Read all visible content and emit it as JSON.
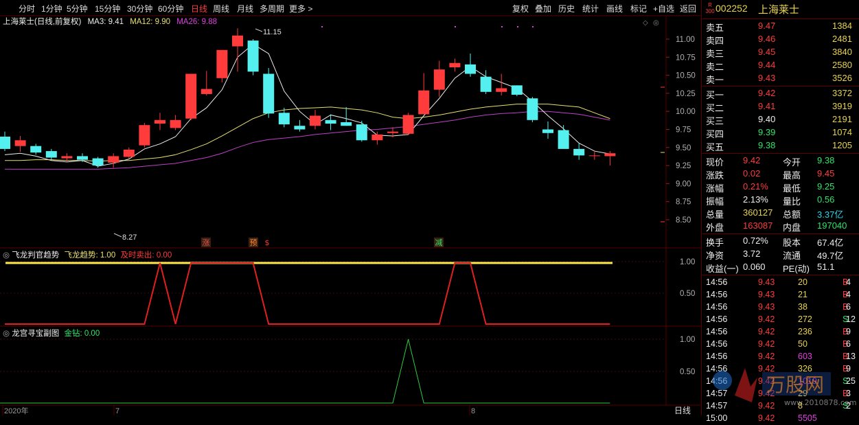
{
  "toolbar": {
    "left": [
      "分时",
      "1分钟",
      "5分钟",
      "15分钟",
      "30分钟",
      "60分钟",
      "日线",
      "周线",
      "月线",
      "多周期",
      "更多 >"
    ],
    "active_index": 6,
    "right": [
      "复权",
      "叠加",
      "历史",
      "统计",
      "画线",
      "标记",
      "+自选",
      "返回"
    ]
  },
  "main_info": {
    "title": "上海莱士(日线,前复权)",
    "ma3": "MA3: 9.41",
    "ma12": "MA12: 9.90",
    "ma26": "MA26: 9.88"
  },
  "price_axis": [
    "11.00",
    "10.75",
    "10.50",
    "10.25",
    "10.00",
    "9.75",
    "9.50",
    "9.25",
    "9.00",
    "8.75",
    "8.50"
  ],
  "annotations": {
    "high": "11.15",
    "low": "8.27",
    "signals": [
      "涨",
      "预",
      "$",
      "减"
    ]
  },
  "pane1": {
    "name": "飞龙判官趋势",
    "s1_label": "飞龙趋势: 1.00",
    "s2_label": "及时卖出: 0.00",
    "axis": [
      "1.00",
      "0.50"
    ]
  },
  "pane2": {
    "name": "龙宫寻宝副图",
    "s1_label": "金钻: 0.00",
    "axis": [
      "1.00",
      "0.50"
    ]
  },
  "x_axis": {
    "labels": [
      "2020年",
      "7",
      "8"
    ],
    "period": "日线"
  },
  "colors": {
    "up": "#ff3b3b",
    "down": "#54f0f0",
    "ma3": "#eeeeee",
    "ma12": "#e8e070",
    "ma26": "#c040c8"
  },
  "chart_data": {
    "type": "candlestick",
    "ylim": [
      8.27,
      11.15
    ],
    "candles": [
      {
        "o": 9.65,
        "h": 9.72,
        "l": 9.45,
        "c": 9.48
      },
      {
        "o": 9.52,
        "h": 9.66,
        "l": 9.44,
        "c": 9.6
      },
      {
        "o": 9.52,
        "h": 9.55,
        "l": 9.4,
        "c": 9.43
      },
      {
        "o": 9.45,
        "h": 9.48,
        "l": 9.33,
        "c": 9.36
      },
      {
        "o": 9.35,
        "h": 9.42,
        "l": 9.3,
        "c": 9.38
      },
      {
        "o": 9.38,
        "h": 9.42,
        "l": 9.3,
        "c": 9.33
      },
      {
        "o": 9.35,
        "h": 9.37,
        "l": 9.22,
        "c": 9.25
      },
      {
        "o": 9.29,
        "h": 9.42,
        "l": 9.22,
        "c": 9.38
      },
      {
        "o": 9.37,
        "h": 9.5,
        "l": 9.35,
        "c": 9.47
      },
      {
        "o": 9.53,
        "h": 9.84,
        "l": 9.5,
        "c": 9.81
      },
      {
        "o": 9.83,
        "h": 9.98,
        "l": 9.74,
        "c": 9.88
      },
      {
        "o": 9.77,
        "h": 9.95,
        "l": 9.74,
        "c": 9.88
      },
      {
        "o": 9.9,
        "h": 10.52,
        "l": 9.88,
        "c": 10.52
      },
      {
        "o": 10.24,
        "h": 10.56,
        "l": 10.22,
        "c": 10.31
      },
      {
        "o": 10.46,
        "h": 10.78,
        "l": 10.4,
        "c": 10.85
      },
      {
        "o": 10.9,
        "h": 11.15,
        "l": 10.55,
        "c": 11.05
      },
      {
        "o": 10.98,
        "h": 11.0,
        "l": 10.5,
        "c": 10.55
      },
      {
        "o": 10.52,
        "h": 10.6,
        "l": 9.91,
        "c": 9.97
      },
      {
        "o": 9.98,
        "h": 10.05,
        "l": 9.78,
        "c": 9.82
      },
      {
        "o": 9.8,
        "h": 9.88,
        "l": 9.72,
        "c": 9.75
      },
      {
        "o": 9.8,
        "h": 10.02,
        "l": 9.75,
        "c": 9.94
      },
      {
        "o": 9.88,
        "h": 9.96,
        "l": 9.74,
        "c": 9.83
      },
      {
        "o": 9.85,
        "h": 10.06,
        "l": 9.8,
        "c": 9.8
      },
      {
        "o": 9.82,
        "h": 9.87,
        "l": 9.58,
        "c": 9.6
      },
      {
        "o": 9.6,
        "h": 9.72,
        "l": 9.54,
        "c": 9.68
      },
      {
        "o": 9.7,
        "h": 9.78,
        "l": 9.64,
        "c": 9.72
      },
      {
        "o": 9.69,
        "h": 9.98,
        "l": 9.67,
        "c": 9.95
      },
      {
        "o": 9.96,
        "h": 10.53,
        "l": 9.96,
        "c": 10.29
      },
      {
        "o": 10.3,
        "h": 10.7,
        "l": 10.2,
        "c": 10.58
      },
      {
        "o": 10.61,
        "h": 10.73,
        "l": 10.55,
        "c": 10.67
      },
      {
        "o": 10.65,
        "h": 10.8,
        "l": 10.48,
        "c": 10.52
      },
      {
        "o": 10.48,
        "h": 10.57,
        "l": 10.24,
        "c": 10.27
      },
      {
        "o": 10.27,
        "h": 10.52,
        "l": 10.22,
        "c": 10.32
      },
      {
        "o": 10.36,
        "h": 10.36,
        "l": 10.21,
        "c": 10.23
      },
      {
        "o": 10.18,
        "h": 10.2,
        "l": 9.85,
        "c": 9.88
      },
      {
        "o": 9.75,
        "h": 9.86,
        "l": 9.62,
        "c": 9.7
      },
      {
        "o": 9.74,
        "h": 9.81,
        "l": 9.5,
        "c": 9.48
      },
      {
        "o": 9.48,
        "h": 9.56,
        "l": 9.33,
        "c": 9.39
      },
      {
        "o": 9.39,
        "h": 9.44,
        "l": 9.33,
        "c": 9.39
      },
      {
        "o": 9.38,
        "h": 9.45,
        "l": 9.25,
        "c": 9.42
      }
    ],
    "ma3": [
      9.4,
      9.42,
      9.38,
      9.32,
      9.3,
      9.32,
      9.24,
      9.28,
      9.34,
      9.48,
      9.55,
      9.65,
      9.9,
      10.05,
      10.3,
      10.75,
      10.93,
      10.8,
      10.28,
      10.0,
      9.82,
      9.95,
      9.9,
      9.84,
      9.67,
      9.66,
      9.68,
      9.94,
      10.18,
      10.46,
      10.62,
      10.48,
      10.4,
      10.32,
      10.14,
      9.94,
      9.76,
      9.56,
      9.45,
      9.41
    ],
    "ma12": [
      9.32,
      9.32,
      9.33,
      9.33,
      9.32,
      9.32,
      9.31,
      9.32,
      9.32,
      9.34,
      9.36,
      9.4,
      9.47,
      9.55,
      9.66,
      9.78,
      9.9,
      9.98,
      10.02,
      10.04,
      10.05,
      10.06,
      10.04,
      10.02,
      9.98,
      9.92,
      9.9,
      9.92,
      9.95,
      9.99,
      10.03,
      10.06,
      10.08,
      10.1,
      10.1,
      10.1,
      10.08,
      10.06,
      9.98,
      9.9
    ],
    "ma26": [
      9.2,
      9.2,
      9.2,
      9.2,
      9.2,
      9.2,
      9.2,
      9.21,
      9.22,
      9.24,
      9.26,
      9.28,
      9.32,
      9.36,
      9.42,
      9.5,
      9.57,
      9.61,
      9.63,
      9.65,
      9.68,
      9.7,
      9.72,
      9.74,
      9.75,
      9.77,
      9.79,
      9.82,
      9.85,
      9.88,
      9.92,
      9.95,
      9.97,
      9.98,
      10.0,
      10.0,
      9.98,
      9.96,
      9.92,
      9.88
    ],
    "pane1_trend": [
      1,
      1,
      1,
      1,
      1,
      1,
      1,
      1,
      1,
      1,
      1,
      1,
      1,
      1,
      1,
      1,
      1,
      1,
      1,
      1,
      1,
      1,
      1,
      1,
      1,
      1,
      1,
      1,
      1,
      1,
      1,
      1,
      1,
      1,
      1,
      1,
      1,
      1,
      1,
      1
    ],
    "pane1_sell": [
      0,
      0,
      0,
      0,
      0,
      0,
      0,
      0,
      0,
      0,
      1,
      0,
      1,
      1,
      1,
      1,
      1,
      0,
      0,
      0,
      0,
      0,
      0,
      0,
      0,
      0,
      0,
      0,
      0,
      1,
      1,
      0,
      0,
      0,
      0,
      0,
      0,
      0,
      0,
      0
    ],
    "pane2_gold": [
      0,
      0,
      0,
      0,
      0,
      0,
      0,
      0,
      0,
      0,
      0,
      0,
      0,
      0,
      0,
      0,
      0,
      0,
      0,
      0,
      0,
      0,
      0,
      0,
      0,
      0,
      1,
      0,
      0,
      0,
      0,
      0,
      0,
      0,
      0,
      0,
      0,
      0,
      0,
      0
    ]
  },
  "quote": {
    "badge_top": "R",
    "badge_bottom": "300",
    "code": "002252",
    "name": "上海莱士",
    "asks": [
      {
        "label": "卖五",
        "price": "9.47",
        "vol": "1384"
      },
      {
        "label": "卖四",
        "price": "9.46",
        "vol": "2481"
      },
      {
        "label": "卖三",
        "price": "9.45",
        "vol": "3840"
      },
      {
        "label": "卖二",
        "price": "9.44",
        "vol": "2580"
      },
      {
        "label": "卖一",
        "price": "9.43",
        "vol": "3526"
      }
    ],
    "bids": [
      {
        "label": "买一",
        "price": "9.42",
        "vol": "3372"
      },
      {
        "label": "买二",
        "price": "9.41",
        "vol": "3919"
      },
      {
        "label": "买三",
        "price": "9.40",
        "vol": "2191"
      },
      {
        "label": "买四",
        "price": "9.39",
        "vol": "1074"
      },
      {
        "label": "买五",
        "price": "9.38",
        "vol": "1205"
      }
    ],
    "stats": [
      {
        "l1": "现价",
        "v1": "9.42",
        "l2": "今开",
        "v2": "9.38"
      },
      {
        "l1": "涨跌",
        "v1": "0.02",
        "l2": "最高",
        "v2": "9.45"
      },
      {
        "l1": "涨幅",
        "v1": "0.21%",
        "l2": "最低",
        "v2": "9.25"
      },
      {
        "l1": "振幅",
        "v1": "2.13%",
        "l2": "量比",
        "v2": "0.56"
      },
      {
        "l1": "总量",
        "v1": "360127",
        "l2": "总额",
        "v2": "3.37亿"
      },
      {
        "l1": "外盘",
        "v1": "163087",
        "l2": "内盘",
        "v2": "197040"
      }
    ],
    "stats2": [
      {
        "l1": "换手",
        "v1": "0.72%",
        "l2": "股本",
        "v2": "67.4亿"
      },
      {
        "l1": "净资",
        "v1": "3.72",
        "l2": "流通",
        "v2": "49.7亿"
      },
      {
        "l1": "收益(一)",
        "v1": "0.060",
        "l2": "PE(动)",
        "v2": "51.1"
      }
    ],
    "ticks": [
      {
        "t": "14:56",
        "p": "9.43",
        "v": "20",
        "bs": "B",
        "n": "4"
      },
      {
        "t": "14:56",
        "p": "9.43",
        "v": "21",
        "bs": "B",
        "n": "4"
      },
      {
        "t": "14:56",
        "p": "9.43",
        "v": "38",
        "bs": "B",
        "n": "6"
      },
      {
        "t": "14:56",
        "p": "9.42",
        "v": "272",
        "bs": "S",
        "n": "12"
      },
      {
        "t": "14:56",
        "p": "9.42",
        "v": "236",
        "bs": "B",
        "n": "9"
      },
      {
        "t": "14:56",
        "p": "9.42",
        "v": "50",
        "bs": "B",
        "n": "6"
      },
      {
        "t": "14:56",
        "p": "9.42",
        "v": "603",
        "bs": "B",
        "n": "13"
      },
      {
        "t": "14:56",
        "p": "9.42",
        "v": "326",
        "bs": "B",
        "n": "9"
      },
      {
        "t": "14:56",
        "p": "9.42",
        "v": "1019",
        "bs": "S",
        "n": "25"
      },
      {
        "t": "14:57",
        "p": "9.42",
        "v": "29",
        "bs": "B",
        "n": "3"
      },
      {
        "t": "14:57",
        "p": "9.42",
        "v": "8",
        "bs": "S",
        "n": "2"
      },
      {
        "t": "15:00",
        "p": "9.42",
        "v": "5505",
        "bs": "",
        "n": ""
      }
    ],
    "watermark": "万股网",
    "watermark_url": "www.2010878.com"
  }
}
